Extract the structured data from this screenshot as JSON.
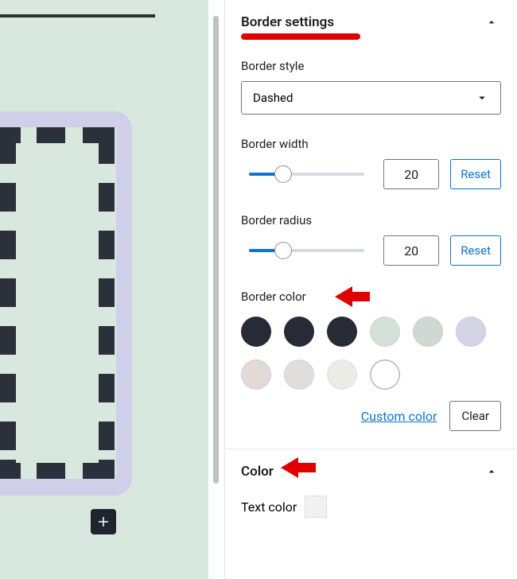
{
  "canvas": {
    "add_block_tooltip": "Add block"
  },
  "border_settings": {
    "title": "Border settings",
    "style": {
      "label": "Border style",
      "value": "Dashed"
    },
    "width": {
      "label": "Border width",
      "value": "20",
      "reset": "Reset",
      "percent": 28
    },
    "radius": {
      "label": "Border radius",
      "value": "20",
      "reset": "Reset",
      "percent": 28
    },
    "color": {
      "label": "Border color",
      "swatches": [
        "#272b36",
        "#272b36",
        "#272b36",
        "#d2e0d7",
        "#cfd9d3",
        "#d4d4e6",
        "#e1dad6",
        "#e0dddb",
        "#ebece5",
        "outline-white"
      ],
      "custom": "Custom color",
      "clear": "Clear"
    }
  },
  "color_section": {
    "title": "Color",
    "text_color_label": "Text color"
  }
}
